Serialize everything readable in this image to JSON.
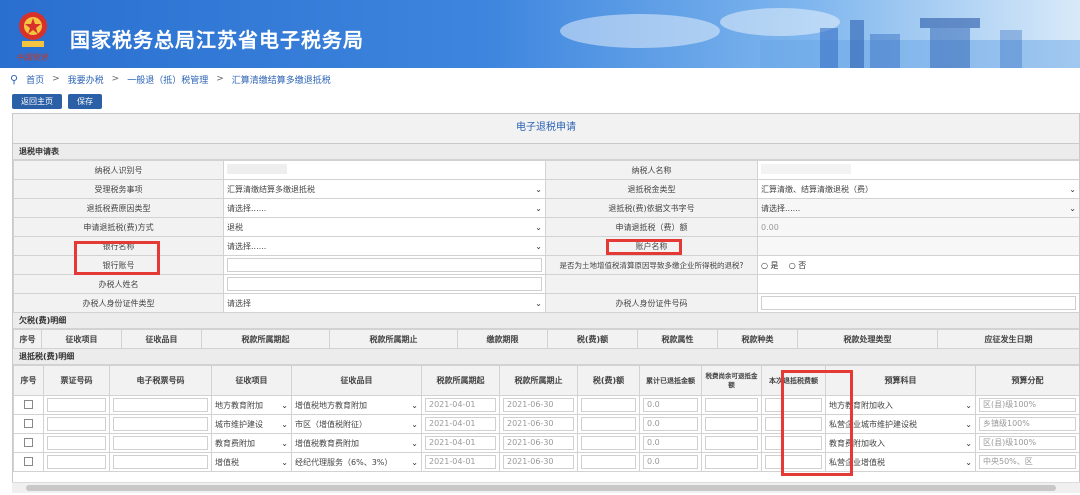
{
  "header": {
    "site_title": "国家税务总局江苏省电子税务局",
    "emblem_caption": "中国税务"
  },
  "breadcrumb": [
    "首页",
    "我要办税",
    "一般退（抵）税管理",
    "汇算清缴结算多缴退抵税"
  ],
  "breadcrumb_sep": ">",
  "toolbar": {
    "back": "返回主页",
    "save": "保存"
  },
  "form_title": "电子退税申请",
  "section1": "退税申请表",
  "rows": [
    {
      "l1": "纳税人识别号",
      "v1": "",
      "l2": "纳税人名称",
      "v2": ""
    },
    {
      "l1": "受理税务事项",
      "v1": "汇算清缴结算多缴退抵税",
      "l2": "退抵税金类型",
      "v2": "汇算清缴、结算清缴退税（费）"
    },
    {
      "l1": "退抵税费原因类型",
      "v1": "请选择......",
      "l2": "退抵税(费)依据文书字号",
      "v2": "请选择......"
    },
    {
      "l1": "申请退抵税(费)方式",
      "v1": "退税",
      "l2": "申请退抵税（费）额",
      "v2": "0.00"
    },
    {
      "l1": "银行名称",
      "v1": "请选择......",
      "l2": "账户名称",
      "v2": ""
    },
    {
      "l1": "银行账号",
      "v1": "",
      "l2": "是否为土地增值税清算原因导致多缴企业所得税的退税?",
      "v2": ""
    },
    {
      "l1": "办税人姓名",
      "v1": "",
      "l2": "",
      "v2": ""
    },
    {
      "l1": "办税人身份证件类型",
      "v1": "请选择",
      "l2": "办税人身份证件号码",
      "v2": ""
    }
  ],
  "radio": {
    "yes": "是",
    "no": "否"
  },
  "section2": "欠税(费)明细",
  "owe_headers": [
    "序号",
    "征收项目",
    "征收品目",
    "税款所属期起",
    "税款所属期止",
    "缴款期限",
    "税(费)额",
    "税款属性",
    "税款种类",
    "税款处理类型",
    "应征发生日期"
  ],
  "section3": "退抵税(费)明细",
  "refund_headers": [
    "序号",
    "票证号码",
    "电子税票号码",
    "征收项目",
    "征收品目",
    "税款所属期起",
    "税款所属期止",
    "税(费)额",
    "累计已退抵金额",
    "税费尚余可退抵金额",
    "本次退抵税费额",
    "预算科目",
    "预算分配"
  ],
  "refund_rows": [
    {
      "item": "地方教育附加",
      "sub": "增值税地方教育附加",
      "start": "2021-04-01",
      "end": "2021-06-30",
      "done": "0.0",
      "budget": "地方教育附加收入",
      "alloc": "区(县)级100%"
    },
    {
      "item": "城市维护建设",
      "sub": "市区（增值税附征）",
      "start": "2021-04-01",
      "end": "2021-06-30",
      "done": "0.0",
      "budget": "私营企业城市维护建设税",
      "alloc": "乡镇级100%"
    },
    {
      "item": "教育费附加",
      "sub": "增值税教育费附加",
      "start": "2021-04-01",
      "end": "2021-06-30",
      "done": "0.0",
      "budget": "教育费附加收入",
      "alloc": "区(县)级100%"
    },
    {
      "item": "增值税",
      "sub": "经纪代理服务（6%、3%）",
      "start": "2021-04-01",
      "end": "2021-06-30",
      "done": "0.0",
      "budget": "私营企业增值税",
      "alloc": "中央50%、区"
    }
  ],
  "colors": {
    "brand": "#2b5fa6",
    "highlight": "#e53935"
  }
}
